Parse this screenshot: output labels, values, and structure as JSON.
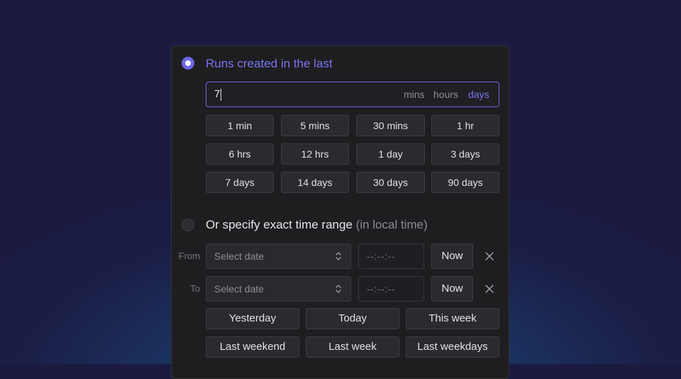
{
  "relative": {
    "heading": "Runs created in the last",
    "value": "7",
    "units": [
      "mins",
      "hours",
      "days"
    ],
    "selected_unit": "days",
    "presets": [
      [
        "1 min",
        "5 mins",
        "30 mins",
        "1 hr"
      ],
      [
        "6 hrs",
        "12 hrs",
        "1 day",
        "3 days"
      ],
      [
        "7 days",
        "14 days",
        "30 days",
        "90 days"
      ]
    ]
  },
  "exact": {
    "heading": "Or specify exact time range",
    "heading_suffix": "(in local time)",
    "from_label": "From",
    "to_label": "To",
    "date_placeholder": "Select date",
    "time_placeholder": "--:--:--",
    "now_label": "Now",
    "quick": [
      [
        "Yesterday",
        "Today",
        "This week"
      ],
      [
        "Last weekend",
        "Last week",
        "Last weekdays"
      ]
    ]
  },
  "colors": {
    "accent": "#6d66e8"
  }
}
